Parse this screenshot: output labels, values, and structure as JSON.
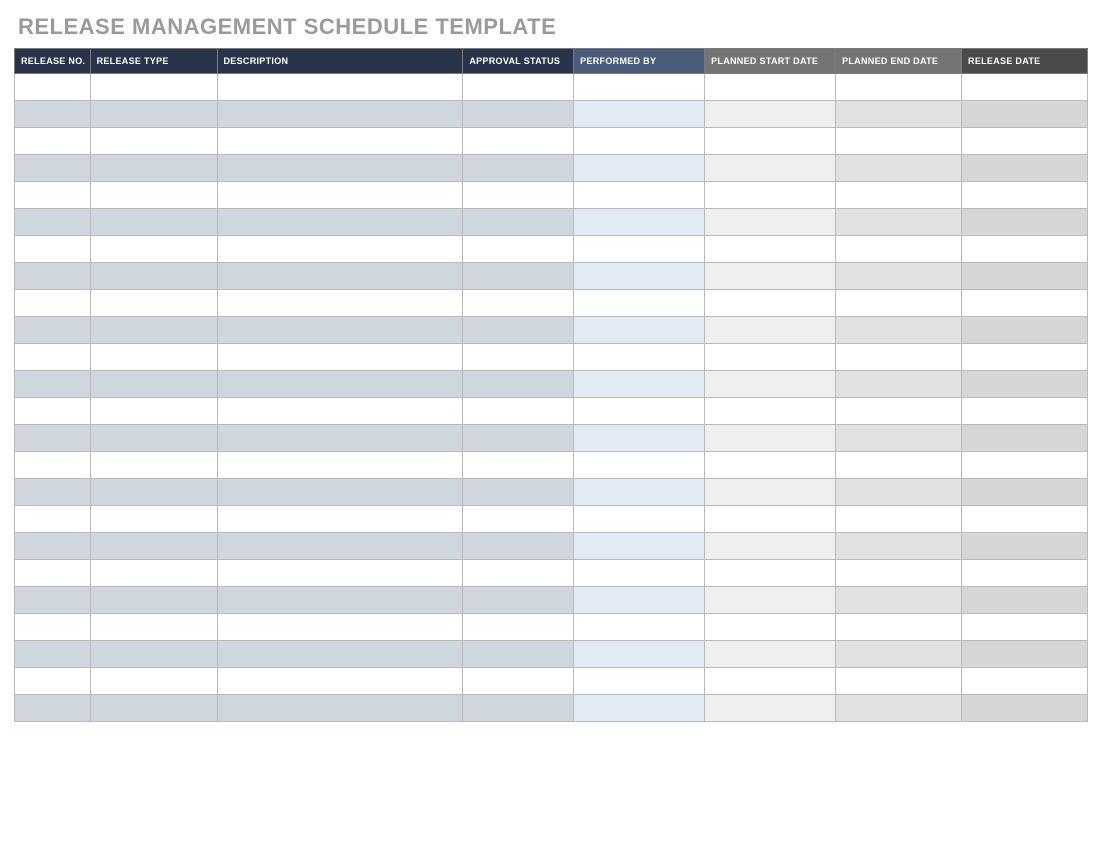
{
  "title": "RELEASE MANAGEMENT SCHEDULE TEMPLATE",
  "columns": [
    {
      "label": "RELEASE NO."
    },
    {
      "label": "RELEASE TYPE"
    },
    {
      "label": "DESCRIPTION"
    },
    {
      "label": "APPROVAL STATUS"
    },
    {
      "label": "PERFORMED BY"
    },
    {
      "label": "PLANNED START DATE"
    },
    {
      "label": "PLANNED END DATE"
    },
    {
      "label": "RELEASE DATE"
    }
  ],
  "row_count": 24,
  "rows": [
    {
      "release_no": "",
      "release_type": "",
      "description": "",
      "approval_status": "",
      "performed_by": "",
      "planned_start_date": "",
      "planned_end_date": "",
      "release_date": ""
    },
    {
      "release_no": "",
      "release_type": "",
      "description": "",
      "approval_status": "",
      "performed_by": "",
      "planned_start_date": "",
      "planned_end_date": "",
      "release_date": ""
    },
    {
      "release_no": "",
      "release_type": "",
      "description": "",
      "approval_status": "",
      "performed_by": "",
      "planned_start_date": "",
      "planned_end_date": "",
      "release_date": ""
    },
    {
      "release_no": "",
      "release_type": "",
      "description": "",
      "approval_status": "",
      "performed_by": "",
      "planned_start_date": "",
      "planned_end_date": "",
      "release_date": ""
    },
    {
      "release_no": "",
      "release_type": "",
      "description": "",
      "approval_status": "",
      "performed_by": "",
      "planned_start_date": "",
      "planned_end_date": "",
      "release_date": ""
    },
    {
      "release_no": "",
      "release_type": "",
      "description": "",
      "approval_status": "",
      "performed_by": "",
      "planned_start_date": "",
      "planned_end_date": "",
      "release_date": ""
    },
    {
      "release_no": "",
      "release_type": "",
      "description": "",
      "approval_status": "",
      "performed_by": "",
      "planned_start_date": "",
      "planned_end_date": "",
      "release_date": ""
    },
    {
      "release_no": "",
      "release_type": "",
      "description": "",
      "approval_status": "",
      "performed_by": "",
      "planned_start_date": "",
      "planned_end_date": "",
      "release_date": ""
    },
    {
      "release_no": "",
      "release_type": "",
      "description": "",
      "approval_status": "",
      "performed_by": "",
      "planned_start_date": "",
      "planned_end_date": "",
      "release_date": ""
    },
    {
      "release_no": "",
      "release_type": "",
      "description": "",
      "approval_status": "",
      "performed_by": "",
      "planned_start_date": "",
      "planned_end_date": "",
      "release_date": ""
    },
    {
      "release_no": "",
      "release_type": "",
      "description": "",
      "approval_status": "",
      "performed_by": "",
      "planned_start_date": "",
      "planned_end_date": "",
      "release_date": ""
    },
    {
      "release_no": "",
      "release_type": "",
      "description": "",
      "approval_status": "",
      "performed_by": "",
      "planned_start_date": "",
      "planned_end_date": "",
      "release_date": ""
    },
    {
      "release_no": "",
      "release_type": "",
      "description": "",
      "approval_status": "",
      "performed_by": "",
      "planned_start_date": "",
      "planned_end_date": "",
      "release_date": ""
    },
    {
      "release_no": "",
      "release_type": "",
      "description": "",
      "approval_status": "",
      "performed_by": "",
      "planned_start_date": "",
      "planned_end_date": "",
      "release_date": ""
    },
    {
      "release_no": "",
      "release_type": "",
      "description": "",
      "approval_status": "",
      "performed_by": "",
      "planned_start_date": "",
      "planned_end_date": "",
      "release_date": ""
    },
    {
      "release_no": "",
      "release_type": "",
      "description": "",
      "approval_status": "",
      "performed_by": "",
      "planned_start_date": "",
      "planned_end_date": "",
      "release_date": ""
    },
    {
      "release_no": "",
      "release_type": "",
      "description": "",
      "approval_status": "",
      "performed_by": "",
      "planned_start_date": "",
      "planned_end_date": "",
      "release_date": ""
    },
    {
      "release_no": "",
      "release_type": "",
      "description": "",
      "approval_status": "",
      "performed_by": "",
      "planned_start_date": "",
      "planned_end_date": "",
      "release_date": ""
    },
    {
      "release_no": "",
      "release_type": "",
      "description": "",
      "approval_status": "",
      "performed_by": "",
      "planned_start_date": "",
      "planned_end_date": "",
      "release_date": ""
    },
    {
      "release_no": "",
      "release_type": "",
      "description": "",
      "approval_status": "",
      "performed_by": "",
      "planned_start_date": "",
      "planned_end_date": "",
      "release_date": ""
    },
    {
      "release_no": "",
      "release_type": "",
      "description": "",
      "approval_status": "",
      "performed_by": "",
      "planned_start_date": "",
      "planned_end_date": "",
      "release_date": ""
    },
    {
      "release_no": "",
      "release_type": "",
      "description": "",
      "approval_status": "",
      "performed_by": "",
      "planned_start_date": "",
      "planned_end_date": "",
      "release_date": ""
    },
    {
      "release_no": "",
      "release_type": "",
      "description": "",
      "approval_status": "",
      "performed_by": "",
      "planned_start_date": "",
      "planned_end_date": "",
      "release_date": ""
    },
    {
      "release_no": "",
      "release_type": "",
      "description": "",
      "approval_status": "",
      "performed_by": "",
      "planned_start_date": "",
      "planned_end_date": "",
      "release_date": ""
    }
  ]
}
